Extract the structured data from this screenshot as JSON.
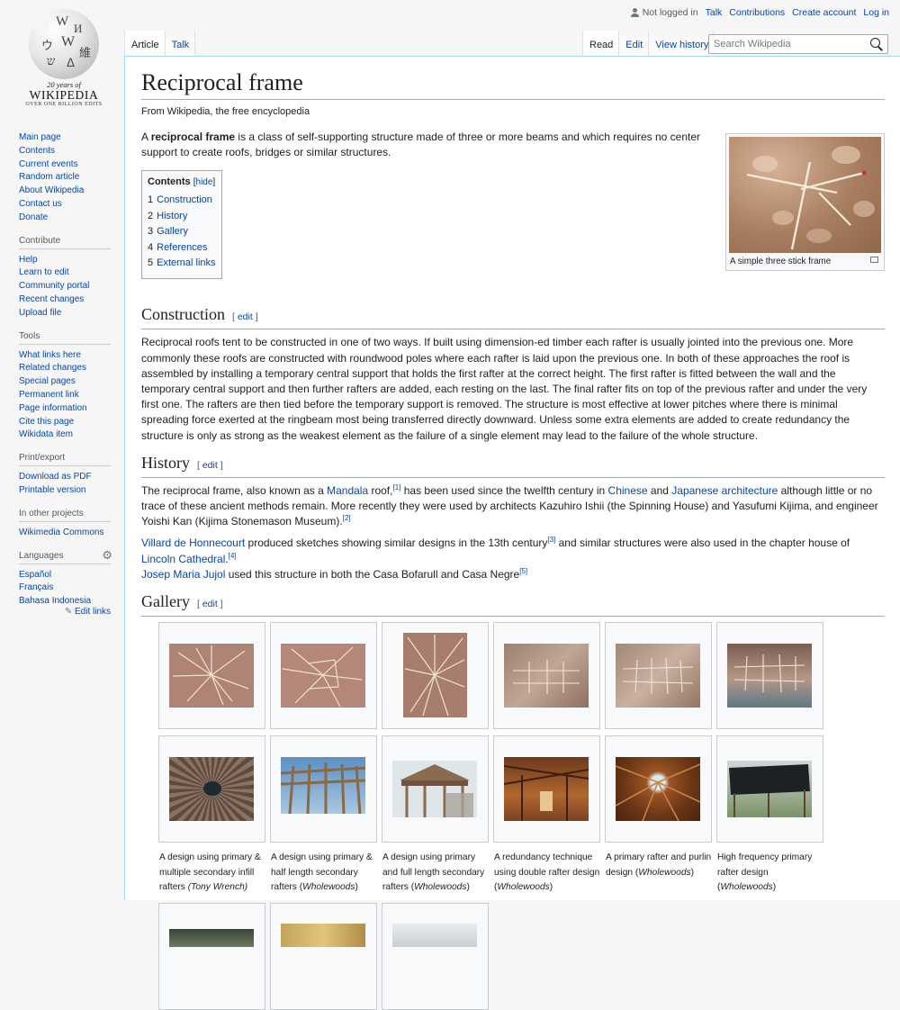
{
  "personal": {
    "not_logged_in": "Not logged in",
    "talk": "Talk",
    "contributions": "Contributions",
    "create_account": "Create account",
    "log_in": "Log in"
  },
  "logo": {
    "anniversary": "20 years of",
    "wordmark": "Wikipedia",
    "motto": "Over One Billion Edits"
  },
  "sidebar": {
    "main": [
      "Main page",
      "Contents",
      "Current events",
      "Random article",
      "About Wikipedia",
      "Contact us",
      "Donate"
    ],
    "contribute": {
      "heading": "Contribute",
      "items": [
        "Help",
        "Learn to edit",
        "Community portal",
        "Recent changes",
        "Upload file"
      ]
    },
    "tools": {
      "heading": "Tools",
      "items": [
        "What links here",
        "Related changes",
        "Special pages",
        "Permanent link",
        "Page information",
        "Cite this page",
        "Wikidata item"
      ]
    },
    "print": {
      "heading": "Print/export",
      "items": [
        "Download as PDF",
        "Printable version"
      ]
    },
    "projects": {
      "heading": "In other projects",
      "items": [
        "Wikimedia Commons"
      ]
    },
    "languages": {
      "heading": "Languages",
      "items": [
        "Español",
        "Français",
        "Bahasa Indonesia"
      ],
      "edit_links": "Edit links"
    }
  },
  "tabs": {
    "article": "Article",
    "talk": "Talk",
    "read": "Read",
    "edit": "Edit",
    "history": "View history"
  },
  "search": {
    "placeholder": "Search Wikipedia"
  },
  "article": {
    "title": "Reciprocal frame",
    "subtitle": "From Wikipedia, the free encyclopedia",
    "intro_a": "A ",
    "intro_bold": "reciprocal frame",
    "intro_b": " is a class of self-supporting structure made of three or more beams and which requires no center support to create roofs, bridges or similar structures.",
    "thumb_caption": "A simple three stick frame",
    "toc": {
      "title": "Contents",
      "hide": "hide",
      "items": [
        {
          "num": "1",
          "label": "Construction"
        },
        {
          "num": "2",
          "label": "History"
        },
        {
          "num": "3",
          "label": "Gallery"
        },
        {
          "num": "4",
          "label": "References"
        },
        {
          "num": "5",
          "label": "External links"
        }
      ]
    },
    "edit_label": "edit",
    "construction": {
      "heading": "Construction",
      "text": "Reciprocal roofs tent to be constructed in one of two ways. If built using dimension-ed timber each rafter is usually jointed into the previous one. More commonly these roofs are constructed with roundwood poles where each rafter is laid upon the previous one. In both of these approaches the roof is assembled by installing a temporary central support that holds the first rafter at the correct height. The first rafter is fitted between the wall and the temporary central support and then further rafters are added, each resting on the last. The final rafter fits on top of the previous rafter and under the very first one. The rafters are then tied before the temporary support is removed. The structure is most effective at lower pitches where there is minimal spreading force exerted at the ringbeam most being transferred directly downward. Unless some extra elements are added to create redundancy the structure is only as strong as the weakest element as the failure of a single element may lead to the failure of the whole structure."
    },
    "history": {
      "heading": "History",
      "p1": {
        "a": "The reciprocal frame, also known as a ",
        "link1": "Mandala",
        "b": " roof,",
        "ref1": "[1]",
        "c": " has been used since the twelfth century in ",
        "link2": "Chinese",
        "d": " and ",
        "link3": "Japanese architecture",
        "e": " although little or no trace of these ancient methods remain. More recently they were used by architects Kazuhiro Ishii (the Spinning House) and Yasufumi Kijima, and engineer Yoishi Kan (Kijima Stonemason Museum).",
        "ref2": "[2]"
      },
      "p2": {
        "link1": "Villard de Honnecourt",
        "a": " produced sketches showing similar designs in the 13th century",
        "ref3": "[3]",
        "b": " and similar structures were also used in the chapter house of ",
        "link2": "Lincoln Cathedral",
        "c": ".",
        "ref4": "[4]",
        "link3": "Josep Maria Jujol",
        "d": " used this structure in both the Casa Bofarull and Casa Negre",
        "ref5": "[5]"
      }
    },
    "gallery": {
      "heading": "Gallery",
      "captions": [
        {
          "text": "A design using primary & multiple secondary infill rafters ",
          "credit": "(Tony Wrench)"
        },
        {
          "text": "A design using primary & half length secondary rafters (",
          "credit": "Wholewoods",
          "close": ")"
        },
        {
          "text": "A design using primary and full length secondary rafters (",
          "credit": "Wholewoods",
          "close": ")"
        },
        {
          "text": "A redundancy technique using double rafter design (",
          "credit": "Wholewoods",
          "close": ")"
        },
        {
          "text": "A primary rafter and purlin design (",
          "credit": "Wholewoods",
          "close": ")"
        },
        {
          "text": "High frequency primary rafter design (",
          "credit": "Wholewoods",
          "close": ")"
        }
      ]
    }
  }
}
